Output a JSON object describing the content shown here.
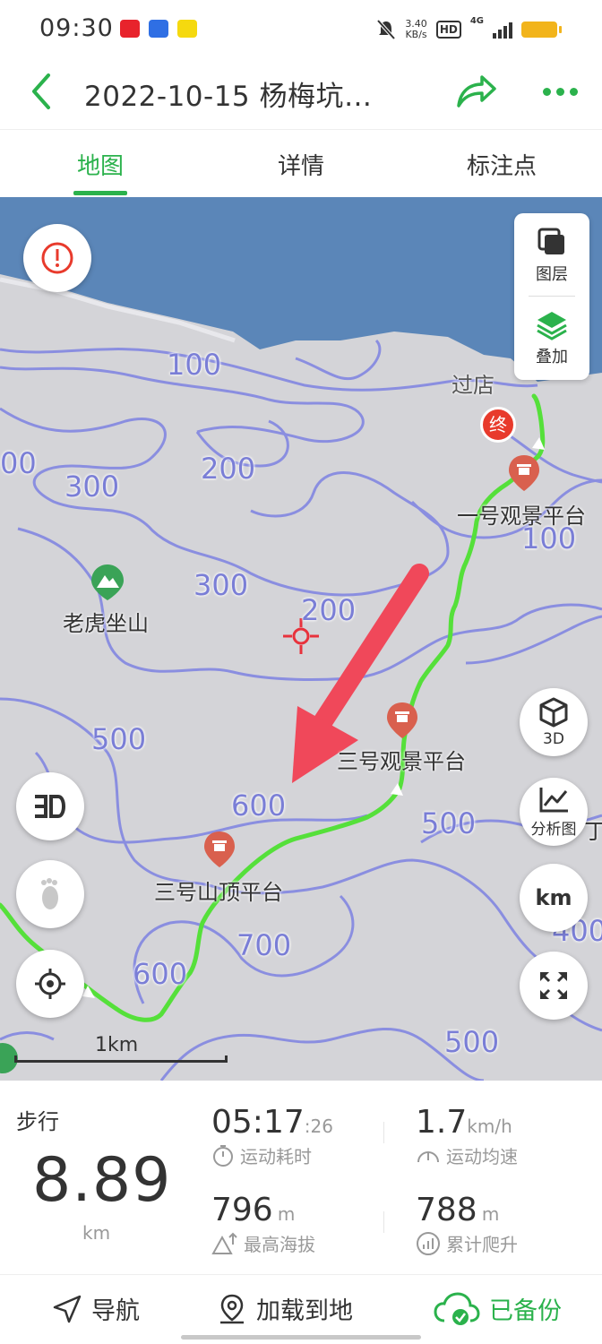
{
  "status_bar": {
    "time": "09:30",
    "net_speed_value": "3.40",
    "net_speed_unit": "KB/s",
    "hd_badge": "HD",
    "network": "4G"
  },
  "header": {
    "title": "2022-10-15 杨梅坑…"
  },
  "tabs": [
    {
      "label": "地图",
      "active": true
    },
    {
      "label": "详情",
      "active": false
    },
    {
      "label": "标注点",
      "active": false
    }
  ],
  "map": {
    "layer_label": "图层",
    "overlay_label": "叠加",
    "btn_3d_label": "3D",
    "analysis_label": "分析图",
    "unit_btn_label": "km",
    "scale_label": "1km",
    "end_marker": "终",
    "place_labels": {
      "guodian": "过店",
      "platform1": "一号观景平台",
      "laohu": "老虎坐山",
      "platform3": "三号观景平台",
      "summit3": "三号山顶平台",
      "edge_partial": "丁"
    },
    "contour_labels": {
      "c100a": "100",
      "c100b": "100",
      "c200a": "200",
      "c200b": "200",
      "c300a": "300",
      "c300b": "300",
      "c500a": "500",
      "c500b": "500",
      "c500c": "500",
      "c600a": "600",
      "c600b": "600",
      "c700": "700",
      "c400": "400",
      "c00": "00"
    },
    "colors": {
      "sea": "#5b86b8",
      "land": "#d4d4d8",
      "contour": "#8a8ee0",
      "track": "#55e03a",
      "arrow": "#f0485a",
      "accent": "#2bb24c"
    }
  },
  "stats": {
    "mode": "步行",
    "distance_value": "8.89",
    "distance_unit": "km",
    "duration": {
      "value": "05:17",
      "suffix": ":26",
      "label": "运动耗时"
    },
    "avg_speed": {
      "value": "1.7",
      "unit": "km/h",
      "label": "运动均速"
    },
    "max_alt": {
      "value": "796",
      "unit": "m",
      "label": "最高海拔"
    },
    "ascent": {
      "value": "788",
      "unit": "m",
      "label": "累计爬升"
    }
  },
  "bottom_bar": {
    "navigate": "导航",
    "load_to_map": "加载到地",
    "backed_up": "已备份"
  }
}
